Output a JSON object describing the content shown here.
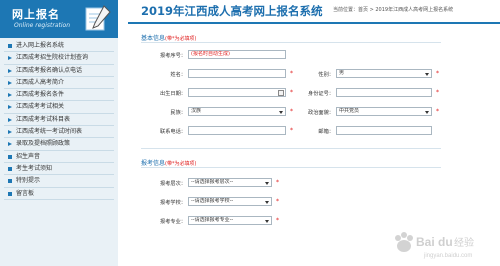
{
  "sidebar": {
    "title": "网上报名",
    "subtitle": "Online registration",
    "items": [
      "进入网上报名系统",
      "江西成考招生院校计划查询",
      "江西成考报名确认点电话",
      "江西成人高考简介",
      "江西成考报名条件",
      "江西成考考试相关",
      "江西成考考试科目表",
      "江西成考统一考试时间表",
      "录取及提档照顾政策",
      "招生声音",
      "考生考试须知",
      "特别提示",
      "留言板"
    ]
  },
  "header": {
    "title": "2019年江西成人高考网上报名系统",
    "breadcrumb": "当前位置：首页 > 2019年江西成人高考网上报名系统"
  },
  "basic": {
    "title": "基本信息",
    "required_note": "(带*为必填项)",
    "fields": {
      "id_label": "报考序号：",
      "id_value": "(报名时自动生成)",
      "name_label": "姓名：",
      "gender_label": "性别：",
      "gender_value": "男",
      "birth_label": "出生日期：",
      "idcard_label": "身份证号：",
      "nation_label": "民族：",
      "nation_value": "汉族",
      "politics_label": "政治面貌：",
      "politics_value": "中共党员",
      "phone_label": "联系电话：",
      "email_label": "邮箱："
    },
    "star": "*"
  },
  "apply": {
    "title": "报考信息",
    "required_note": "(带*为必填项)",
    "level_label": "报考层次：",
    "level_value": "--请选择报考层次--",
    "school_label": "报考学校：",
    "school_value": "--请选择报考学校--",
    "major_label": "报考专业：",
    "major_value": "--请选择报考专业--"
  },
  "colors": {
    "brand": "#1d77b4",
    "required": "#e02020"
  },
  "watermark": {
    "text": "Baidu 经验",
    "url": "jingyan.baidu.com"
  }
}
